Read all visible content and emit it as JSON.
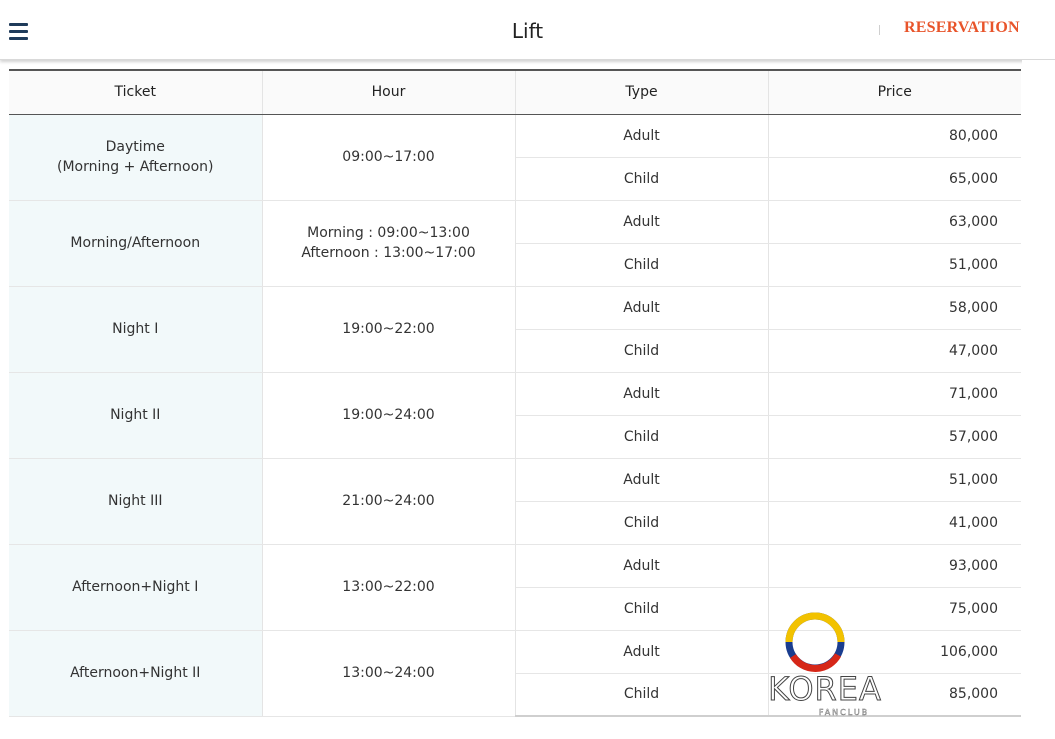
{
  "header": {
    "title": "Lift",
    "reservation_label": "RESERVATION"
  },
  "colors": {
    "accent": "#e8542a",
    "menu_icon": "#1f3b5a",
    "ticket_cell_bg": "#f2f9fa"
  },
  "table": {
    "columns": [
      "Ticket",
      "Hour",
      "Type",
      "Price"
    ],
    "groups": [
      {
        "ticket": [
          "Daytime",
          "(Morning + Afternoon)"
        ],
        "hour": [
          "09:00~17:00"
        ],
        "adult": "80,000",
        "child": "65,000"
      },
      {
        "ticket": [
          "Morning/Afternoon"
        ],
        "hour": [
          "Morning : 09:00~13:00",
          "Afternoon : 13:00~17:00"
        ],
        "adult": "63,000",
        "child": "51,000"
      },
      {
        "ticket": [
          "Night I"
        ],
        "hour": [
          "19:00~22:00"
        ],
        "adult": "58,000",
        "child": "47,000"
      },
      {
        "ticket": [
          "Night II"
        ],
        "hour": [
          "19:00~24:00"
        ],
        "adult": "71,000",
        "child": "57,000"
      },
      {
        "ticket": [
          "Night III"
        ],
        "hour": [
          "21:00~24:00"
        ],
        "adult": "51,000",
        "child": "41,000"
      },
      {
        "ticket": [
          "Afternoon+Night I"
        ],
        "hour": [
          "13:00~22:00"
        ],
        "adult": "93,000",
        "child": "75,000"
      },
      {
        "ticket": [
          "Afternoon+Night II"
        ],
        "hour": [
          "13:00~24:00"
        ],
        "adult": "106,000",
        "child": "85,000"
      }
    ],
    "type_labels": {
      "adult": "Adult",
      "child": "Child"
    }
  },
  "watermark": {
    "text": "KOREA",
    "subtext": "FANCLUB"
  }
}
